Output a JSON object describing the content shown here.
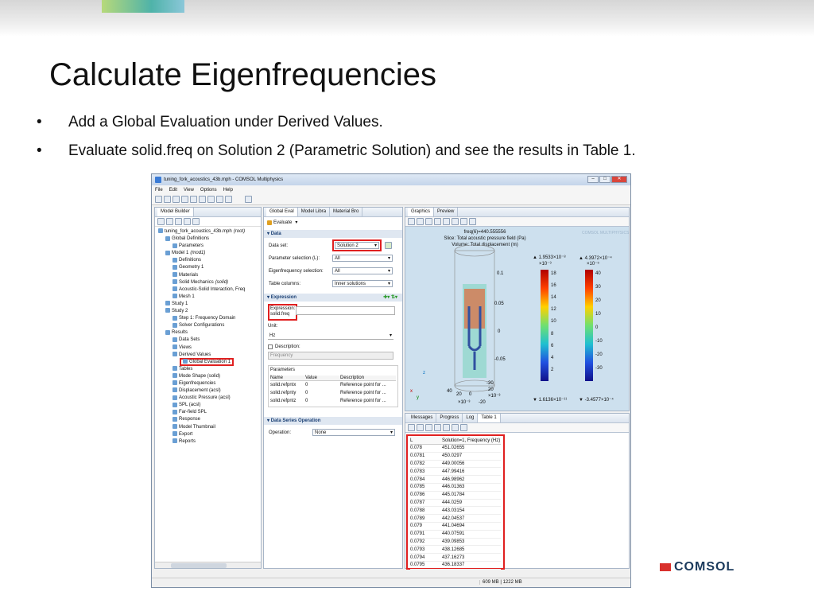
{
  "slide": {
    "title": "Calculate Eigenfrequencies",
    "bullets": [
      "Add a Global Evaluation under Derived Values.",
      "Evaluate solid.freq on Solution 2 (Parametric Solution) and see the results in Table 1."
    ],
    "brand": "COMSOL"
  },
  "app": {
    "title": "tuning_fork_acoustics_43b.mph - COMSOL Multiphysics",
    "menu": [
      "File",
      "Edit",
      "View",
      "Options",
      "Help"
    ],
    "status": "609 MB | 1222 MB"
  },
  "model_builder": {
    "tab": "Model Builder",
    "tree": [
      {
        "depth": 0,
        "label": "tuning_fork_acoustics_43b.mph",
        "suffix": "(root)"
      },
      {
        "depth": 1,
        "label": "Global Definitions"
      },
      {
        "depth": 2,
        "label": "Parameters"
      },
      {
        "depth": 1,
        "label": "Model 1",
        "suffix": "(mod1)"
      },
      {
        "depth": 2,
        "label": "Definitions"
      },
      {
        "depth": 2,
        "label": "Geometry 1"
      },
      {
        "depth": 2,
        "label": "Materials"
      },
      {
        "depth": 2,
        "label": "Solid Mechanics",
        "suffix": "(solid)"
      },
      {
        "depth": 2,
        "label": "Acoustic-Solid Interaction, Freq"
      },
      {
        "depth": 2,
        "label": "Mesh 1"
      },
      {
        "depth": 1,
        "label": "Study 1"
      },
      {
        "depth": 1,
        "label": "Study 2"
      },
      {
        "depth": 2,
        "label": "Step 1: Frequency Domain"
      },
      {
        "depth": 2,
        "label": "Solver Configurations"
      },
      {
        "depth": 1,
        "label": "Results"
      },
      {
        "depth": 2,
        "label": "Data Sets"
      },
      {
        "depth": 2,
        "label": "Views"
      },
      {
        "depth": 2,
        "label": "Derived Values"
      },
      {
        "depth": 3,
        "label": "Global Evaluation 1",
        "highlight": true
      },
      {
        "depth": 2,
        "label": "Tables"
      },
      {
        "depth": 2,
        "label": "Mode Shape (solid)"
      },
      {
        "depth": 2,
        "label": "Eigenfrequencies"
      },
      {
        "depth": 2,
        "label": "Displacement (acsl)"
      },
      {
        "depth": 2,
        "label": "Acoustic Pressure (acsl)"
      },
      {
        "depth": 2,
        "label": "SPL (acsl)"
      },
      {
        "depth": 2,
        "label": "Far-field SPL"
      },
      {
        "depth": 2,
        "label": "Response"
      },
      {
        "depth": 2,
        "label": "Model Thumbnail"
      },
      {
        "depth": 2,
        "label": "Export"
      },
      {
        "depth": 2,
        "label": "Reports"
      }
    ]
  },
  "settings": {
    "tabs": [
      "Global Eval",
      "Model Libra",
      "Material Bro"
    ],
    "evaluate_label": "Evaluate",
    "data_section": "Data",
    "data_set_label": "Data set:",
    "data_set_value": "Solution 2",
    "param_sel_label": "Parameter selection (L):",
    "param_sel_value": "All",
    "eig_sel_label": "Eigenfrequency selection:",
    "eig_sel_value": "All",
    "table_cols_label": "Table columns:",
    "table_cols_value": "Inner solutions",
    "expression_section": "Expression",
    "expression_label": "Expression:",
    "expression_value": "solid.freq",
    "unit_label": "Unit:",
    "unit_value": "Hz",
    "description_label": "Description:",
    "description_placeholder": "Frequency",
    "parameters_label": "Parameters",
    "param_headers": [
      "Name",
      "Value",
      "Description"
    ],
    "param_rows": [
      [
        "solid.refpntx",
        "0",
        "Reference point for ..."
      ],
      [
        "solid.refpnty",
        "0",
        "Reference point for ..."
      ],
      [
        "solid.refpntz",
        "0",
        "Reference point for ..."
      ]
    ],
    "dso_section": "Data Series Operation",
    "operation_label": "Operation:",
    "operation_value": "None"
  },
  "graphics": {
    "tabs": [
      "Graphics",
      "Preview"
    ],
    "line1": "freq(6)=440.555556",
    "line2": "Slice: Total acoustic pressure field (Pa)",
    "line3": "Volume: Total displacement (m)",
    "cb1_max": "▲ 1.9533×10⁻⁸",
    "cb1_scale": "×10⁻⁹",
    "cb1_ticks": [
      "18",
      "16",
      "14",
      "12",
      "10",
      "8",
      "6",
      "4",
      "2"
    ],
    "cb1_min": "▼ 1.6136×10⁻¹¹",
    "cb2_max": "▲ 4.3972×10⁻⁴",
    "cb2_scale": "×10⁻⁵",
    "cb2_ticks": [
      "40",
      "30",
      "20",
      "10",
      "0",
      "-10",
      "-20",
      "-30"
    ],
    "cb2_min": "▼ -3.4577×10⁻⁴",
    "z_ticks": [
      "0.1",
      "0.05",
      "0",
      "-0.05"
    ],
    "xy_ticks": [
      "40",
      "20",
      "0",
      "-20",
      "-20",
      "0",
      "20"
    ],
    "xy_scale": "×10⁻³",
    "watermark": "COMSOL MULTIPHYSICS"
  },
  "results": {
    "tabs": [
      "Messages",
      "Progress",
      "Log",
      "Table 1"
    ],
    "headers": [
      "L",
      "Solution=1, Frequency (Hz)"
    ],
    "rows": [
      [
        "0.078",
        "451.02655"
      ],
      [
        "0.0781",
        "450.0297"
      ],
      [
        "0.0782",
        "449.00056"
      ],
      [
        "0.0783",
        "447.99416"
      ],
      [
        "0.0784",
        "446.98962"
      ],
      [
        "0.0785",
        "446.01363"
      ],
      [
        "0.0786",
        "445.01784"
      ],
      [
        "0.0787",
        "444.0259"
      ],
      [
        "0.0788",
        "443.03154"
      ],
      [
        "0.0789",
        "442.04537"
      ],
      [
        "0.079",
        "441.04694"
      ],
      [
        "0.0791",
        "440.07591"
      ],
      [
        "0.0792",
        "439.09853"
      ],
      [
        "0.0793",
        "438.12685"
      ],
      [
        "0.0794",
        "437.16273"
      ],
      [
        "0.0795",
        "436.18337"
      ]
    ]
  }
}
